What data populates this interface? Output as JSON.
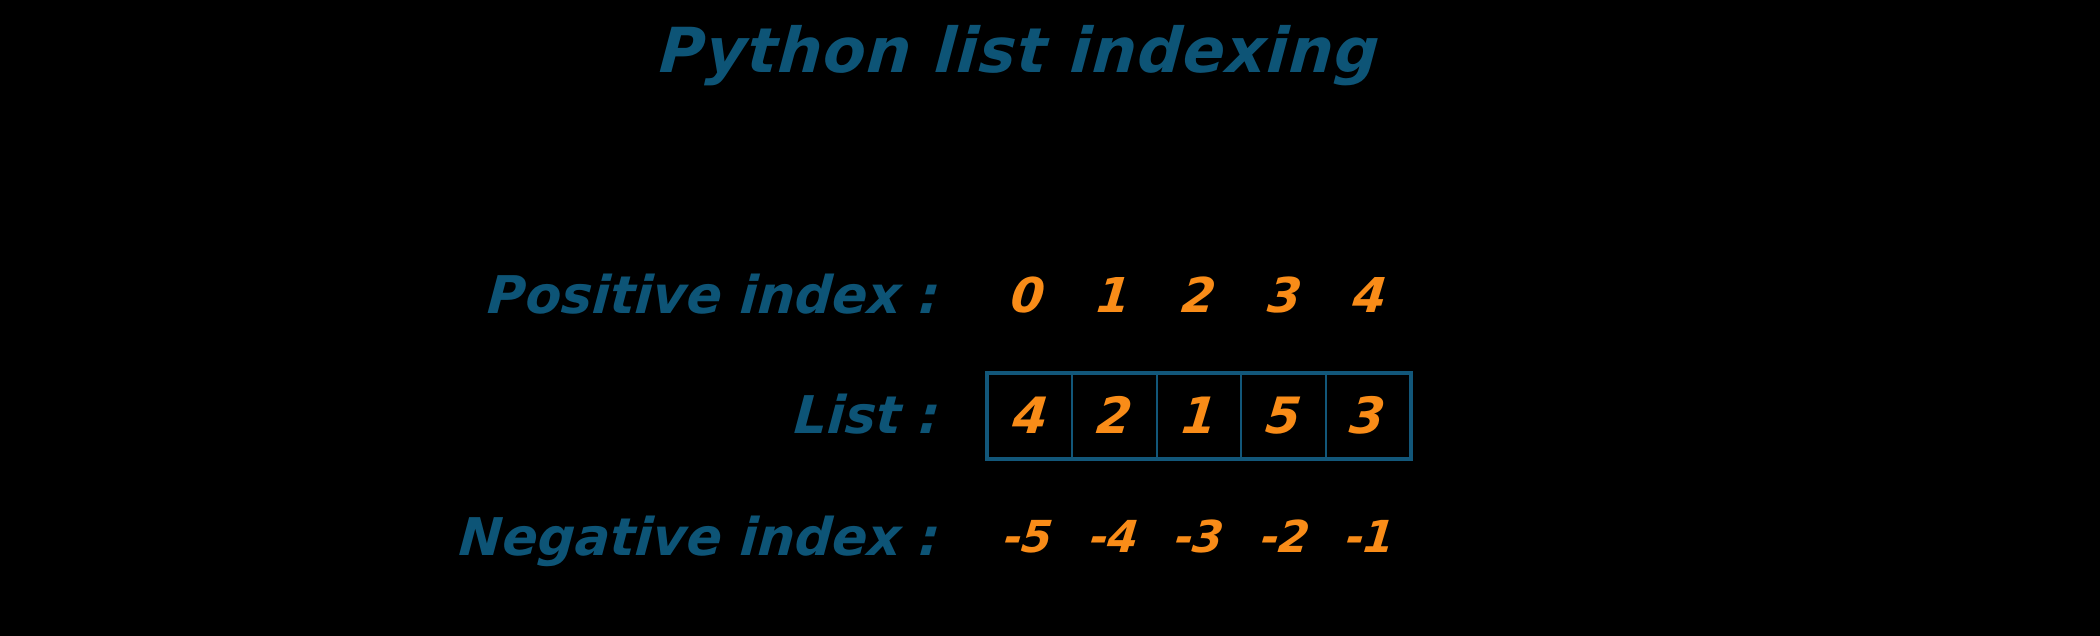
{
  "title": "Python list indexing",
  "colors": {
    "background": "#000000",
    "label": "#0d5476",
    "value": "#f98c18",
    "box_border": "#12577a"
  },
  "rows": {
    "positive": {
      "label": "Positive index :",
      "values": [
        "0",
        "1",
        "2",
        "3",
        "4"
      ]
    },
    "list": {
      "label": "List :",
      "values": [
        "4",
        "2",
        "1",
        "5",
        "3"
      ]
    },
    "negative": {
      "label": "Negative index :",
      "values": [
        "-5",
        "-4",
        "-3",
        "-2",
        "-1"
      ]
    }
  }
}
